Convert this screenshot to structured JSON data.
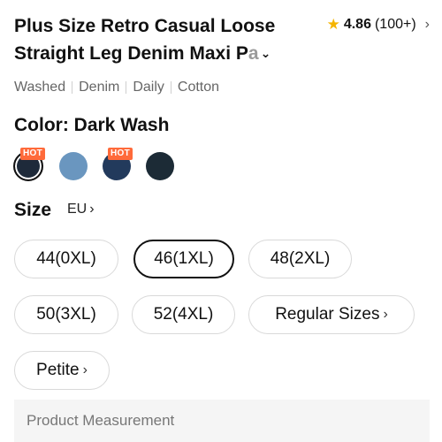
{
  "product": {
    "title_line1": "Plus Size Retro Casual Loose",
    "title_line2": "Straight Leg Denim Maxi P",
    "title_fade": "a",
    "expand_icon": "chevron-down-icon"
  },
  "rating": {
    "score": "4.86",
    "count": "(100+)",
    "star_icon": "star-icon",
    "chevron_icon": "chevron-right-icon"
  },
  "tags": [
    "Washed",
    "Denim",
    "Daily",
    "Cotton"
  ],
  "color": {
    "label": "Color: Dark Wash",
    "swatches": [
      {
        "color": "#1e2a3a",
        "hot": "HOT",
        "selected": true
      },
      {
        "color": "#6a96bf",
        "hot": "",
        "selected": false
      },
      {
        "color": "#223a5c",
        "hot": "HOT",
        "selected": false
      },
      {
        "color": "#1c2b36",
        "hot": "",
        "selected": false
      }
    ],
    "hot_color": "#ff6a3a"
  },
  "size": {
    "label": "Size",
    "region": "EU",
    "options": [
      {
        "label": "44(0XL)",
        "selected": false
      },
      {
        "label": "46(1XL)",
        "selected": true
      },
      {
        "label": "48(2XL)",
        "selected": false
      },
      {
        "label": "50(3XL)",
        "selected": false
      },
      {
        "label": "52(4XL)",
        "selected": false
      },
      {
        "label": "Regular Sizes",
        "selected": false
      },
      {
        "label": "Petite",
        "selected": false
      }
    ]
  },
  "measurement": {
    "label": "Product Measurement"
  }
}
